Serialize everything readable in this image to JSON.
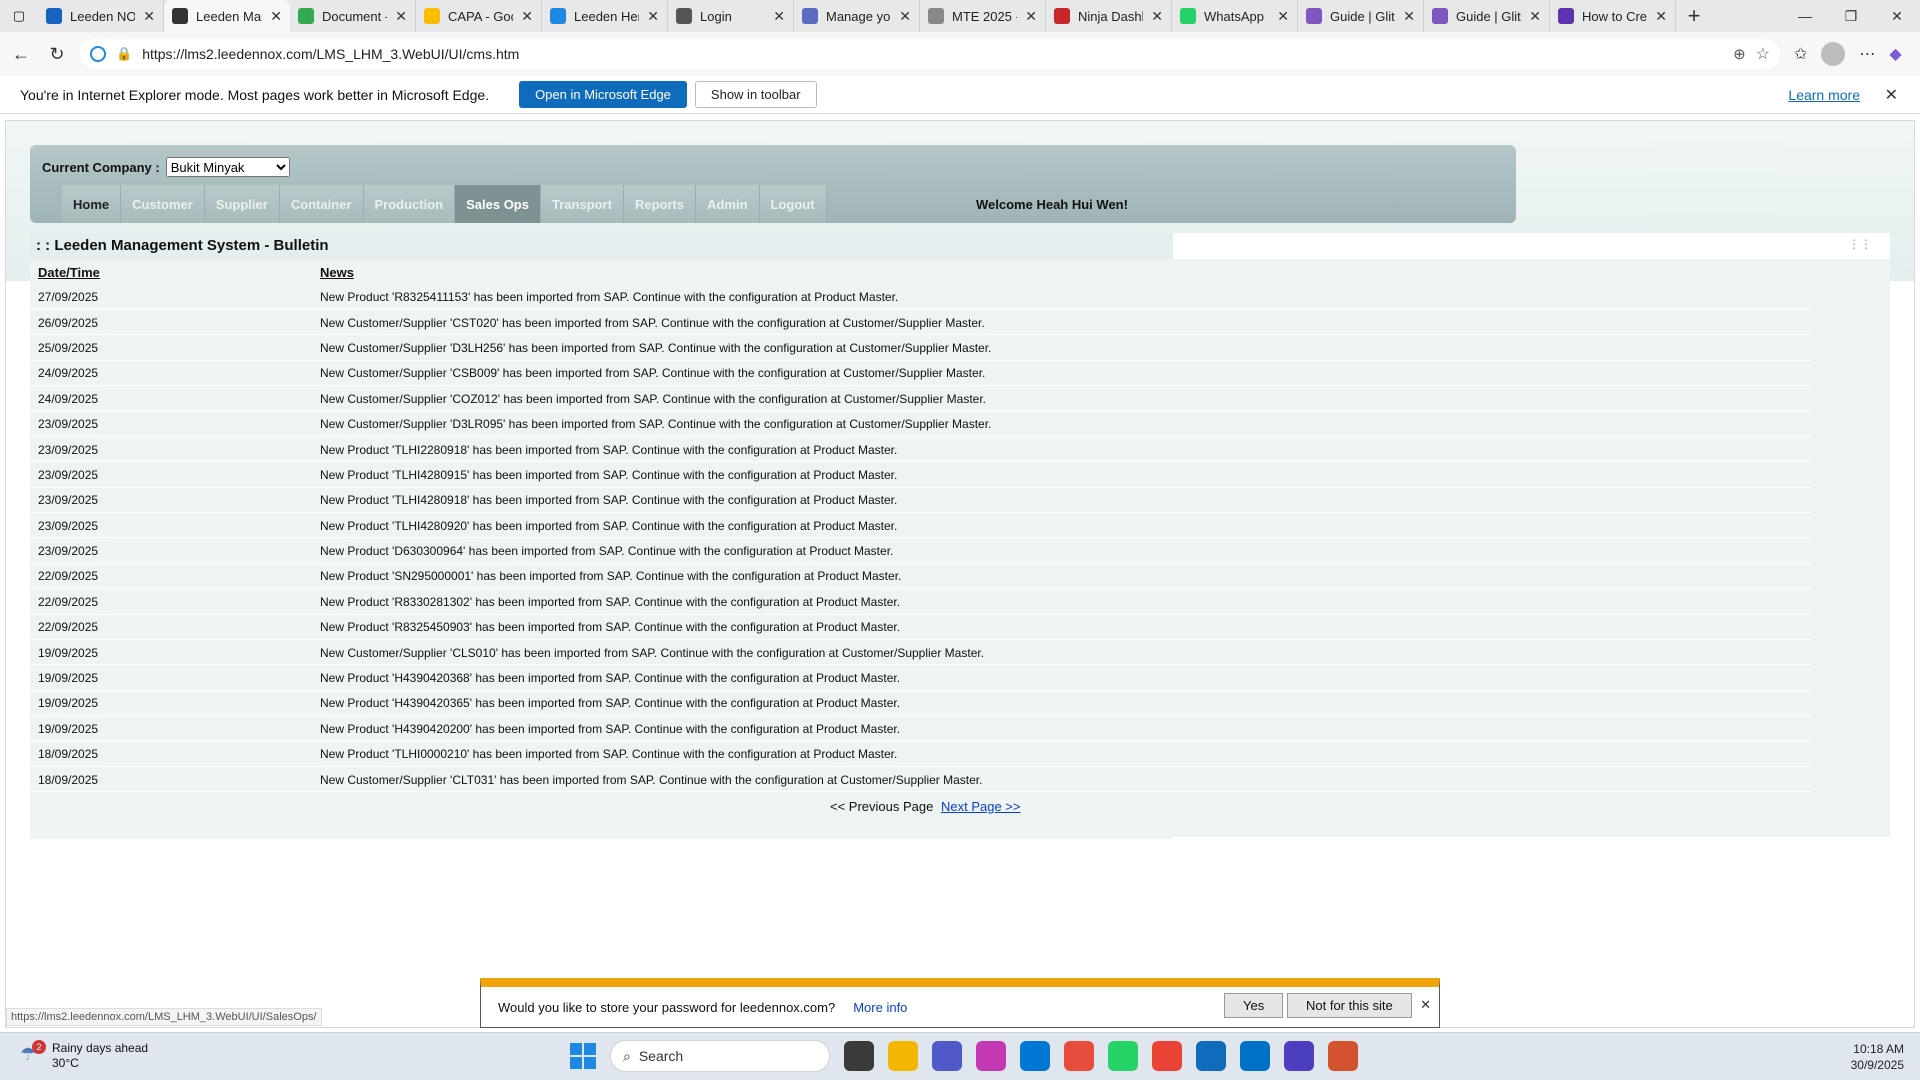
{
  "browser": {
    "tabs": [
      {
        "label": "Leeden NOX",
        "color": "#1565c0"
      },
      {
        "label": "Leeden Man",
        "color": "#333333"
      },
      {
        "label": "Document -",
        "color": "#34a853"
      },
      {
        "label": "CAPA - Goo",
        "color": "#fbbc04"
      },
      {
        "label": "Leeden Her",
        "color": "#1e88e5"
      },
      {
        "label": "Login",
        "color": "#555555"
      },
      {
        "label": "Manage you",
        "color": "#5c6bc0"
      },
      {
        "label": "MTE 2025 -",
        "color": "#888888"
      },
      {
        "label": "Ninja Dashb",
        "color": "#c62828"
      },
      {
        "label": "WhatsApp",
        "color": "#25d366"
      },
      {
        "label": "Guide | Glitt",
        "color": "#7e57c2"
      },
      {
        "label": "Guide | Glitt",
        "color": "#7e57c2"
      },
      {
        "label": "How to Crea",
        "color": "#5e35b1"
      }
    ],
    "url": "https://lms2.leedennox.com/LMS_LHM_3.WebUI/UI/cms.htm"
  },
  "iebar": {
    "message": "You're in Internet Explorer mode. Most pages work better in Microsoft Edge.",
    "open_edge": "Open in Microsoft Edge",
    "show_toolbar": "Show in toolbar",
    "learn_more": "Learn more"
  },
  "header": {
    "company_label": "Current Company :",
    "company_value": "Bukit Minyak",
    "menu": [
      "Home",
      "Customer",
      "Supplier",
      "Container",
      "Production",
      "Sales Ops",
      "Transport",
      "Reports",
      "Admin",
      "Logout"
    ],
    "active_menu": "Sales Ops",
    "welcome": "Welcome Heah Hui Wen!"
  },
  "bulletin": {
    "title": ": : Leeden Management System - Bulletin",
    "col_date": "Date/Time",
    "col_news": "News",
    "rows": [
      {
        "date": "27/09/2025",
        "news": "New Product 'R8325411153' has been imported from SAP. Continue with the configuration at Product Master."
      },
      {
        "date": "26/09/2025",
        "news": "New Customer/Supplier 'CST020' has been imported from SAP. Continue with the configuration at Customer/Supplier Master."
      },
      {
        "date": "25/09/2025",
        "news": "New Customer/Supplier 'D3LH256' has been imported from SAP. Continue with the configuration at Customer/Supplier Master."
      },
      {
        "date": "24/09/2025",
        "news": "New Customer/Supplier 'CSB009' has been imported from SAP. Continue with the configuration at Customer/Supplier Master."
      },
      {
        "date": "24/09/2025",
        "news": "New Customer/Supplier 'COZ012' has been imported from SAP. Continue with the configuration at Customer/Supplier Master."
      },
      {
        "date": "23/09/2025",
        "news": "New Customer/Supplier 'D3LR095' has been imported from SAP. Continue with the configuration at Customer/Supplier Master."
      },
      {
        "date": "23/09/2025",
        "news": "New Product 'TLHI2280918' has been imported from SAP. Continue with the configuration at Product Master."
      },
      {
        "date": "23/09/2025",
        "news": "New Product 'TLHI4280915' has been imported from SAP. Continue with the configuration at Product Master."
      },
      {
        "date": "23/09/2025",
        "news": "New Product 'TLHI4280918' has been imported from SAP. Continue with the configuration at Product Master."
      },
      {
        "date": "23/09/2025",
        "news": "New Product 'TLHI4280920' has been imported from SAP. Continue with the configuration at Product Master."
      },
      {
        "date": "23/09/2025",
        "news": "New Product 'D630300964' has been imported from SAP. Continue with the configuration at Product Master."
      },
      {
        "date": "22/09/2025",
        "news": "New Product 'SN295000001' has been imported from SAP. Continue with the configuration at Product Master."
      },
      {
        "date": "22/09/2025",
        "news": "New Product 'R8330281302' has been imported from SAP. Continue with the configuration at Product Master."
      },
      {
        "date": "22/09/2025",
        "news": "New Product 'R8325450903' has been imported from SAP. Continue with the configuration at Product Master."
      },
      {
        "date": "19/09/2025",
        "news": "New Customer/Supplier 'CLS010' has been imported from SAP. Continue with the configuration at Customer/Supplier Master."
      },
      {
        "date": "19/09/2025",
        "news": "New Product 'H4390420368' has been imported from SAP. Continue with the configuration at Product Master."
      },
      {
        "date": "19/09/2025",
        "news": "New Product 'H4390420365' has been imported from SAP. Continue with the configuration at Product Master."
      },
      {
        "date": "19/09/2025",
        "news": "New Product 'H4390420200' has been imported from SAP. Continue with the configuration at Product Master."
      },
      {
        "date": "18/09/2025",
        "news": "New Product 'TLHI0000210' has been imported from SAP. Continue with the configuration at Product Master."
      },
      {
        "date": "18/09/2025",
        "news": "New Customer/Supplier 'CLT031' has been imported from SAP. Continue with the configuration at Customer/Supplier Master."
      }
    ],
    "prev_page": "<< Previous Page",
    "next_page": "Next Page >>"
  },
  "status_url": "https://lms2.leedennox.com/LMS_LHM_3.WebUI/UI/SalesOps/",
  "password_prompt": {
    "message": "Would you like to store your password for leedennox.com?",
    "more_info": "More info",
    "yes": "Yes",
    "not_for_site": "Not for this site"
  },
  "taskbar": {
    "weather_badge": "2",
    "weather_title": "Rainy days ahead",
    "weather_temp": "30°C",
    "search_label": "Search",
    "time": "10:18 AM",
    "date": "30/9/2025",
    "apps": [
      "#3a3a3a",
      "#f2b705",
      "#5059c9",
      "#c239b3",
      "#0078d4",
      "#e74c3c",
      "#25d366",
      "#ea4335",
      "#0f6cbd",
      "#0072c6",
      "#4b3fbf",
      "#d35230"
    ]
  }
}
